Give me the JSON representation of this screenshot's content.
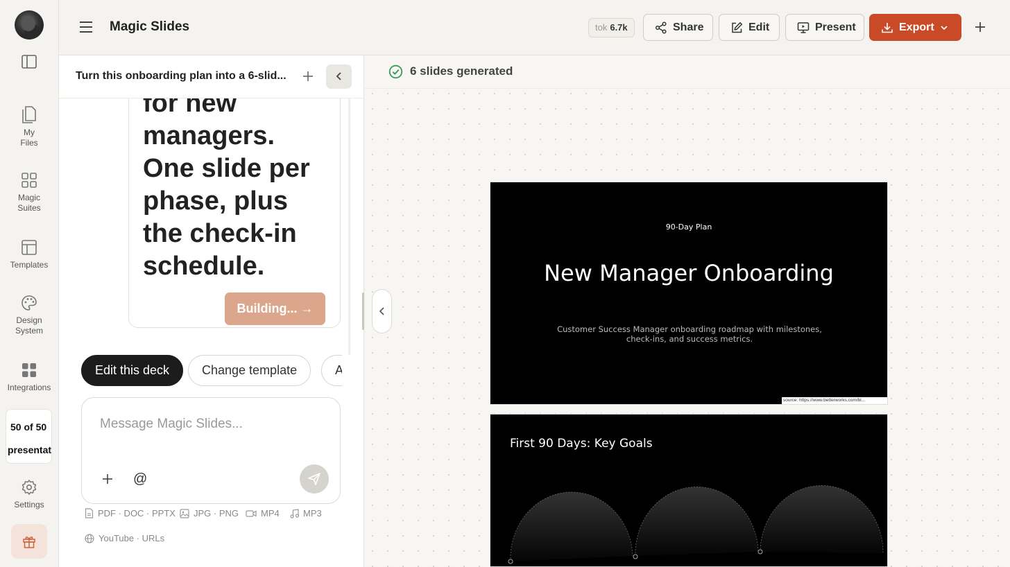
{
  "sidebar": {
    "items": [
      {
        "label_line1": "My",
        "label_line2": "Files",
        "icon": "file-icon"
      },
      {
        "label_line1": "Magic",
        "label_line2": "Suites",
        "icon": "grid-icon"
      },
      {
        "label_line1": "Templates",
        "label_line2": "",
        "icon": "template-icon"
      },
      {
        "label_line1": "Design",
        "label_line2": "System",
        "icon": "palette-icon"
      },
      {
        "label_line1": "Integrations",
        "label_line2": "",
        "icon": "integrations-icon"
      },
      {
        "label_line1": "Settings",
        "label_line2": "",
        "icon": "gear-icon"
      }
    ],
    "quota_line1": "50 of 50",
    "quota_line2": "presentations"
  },
  "header": {
    "title": "Magic Slides",
    "tok_label": "tok",
    "tok_value": "6.7k",
    "share_label": "Share",
    "edit_label": "Edit",
    "present_label": "Present",
    "export_label": "Export",
    "export_color": "#c94a26"
  },
  "chat": {
    "title": "Turn this onboarding plan into a 6-slid...",
    "message_text": "for new managers. One slide per phase, plus the check-in schedule.",
    "building_label": "Building... →",
    "chips": [
      "Edit this deck",
      "Change template",
      "A"
    ],
    "composer_placeholder": "Message Magic Slides...",
    "at_symbol": "@",
    "file_types": [
      "PDF · DOC · PPTX",
      "JPG · PNG",
      "MP4",
      "MP3",
      "YouTube · URLs"
    ]
  },
  "canvas": {
    "status_text": "6 slides generated",
    "status_color": "#3a9a5b",
    "slides": [
      {
        "kicker": "90-Day Plan",
        "title": "New Manager Onboarding",
        "subtitle": "Customer Success Manager onboarding roadmap with milestones, check-ins, and success metrics.",
        "source": "source: https://www.betterworks.com/bl..."
      },
      {
        "title": "First 90 Days: Key Goals"
      }
    ]
  }
}
